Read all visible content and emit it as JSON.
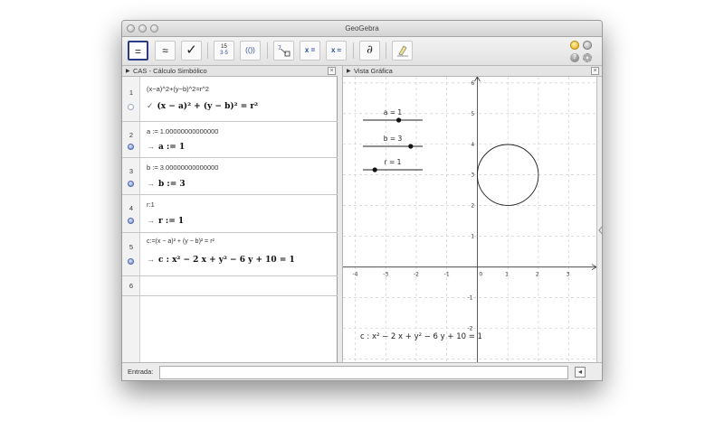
{
  "window": {
    "title": "GeoGebra"
  },
  "toolbar": {
    "tools": [
      {
        "name": "evaluate",
        "label": "="
      },
      {
        "name": "numeric",
        "label": "≈"
      },
      {
        "name": "keep-input",
        "label": "✓"
      },
      {
        "name": "factor",
        "label_top": "15",
        "label_bottom": "3·5"
      },
      {
        "name": "expand",
        "label": "(())"
      },
      {
        "name": "substitute",
        "label": ""
      },
      {
        "name": "solve",
        "label": "x ="
      },
      {
        "name": "nsolve",
        "label": "x ≈"
      },
      {
        "name": "derivative",
        "label": "∂"
      },
      {
        "name": "delete",
        "label": ""
      }
    ]
  },
  "cas_panel": {
    "title": "CAS - Cálculo Simbólico",
    "close": "×"
  },
  "graphics_panel": {
    "title": "Vista Gráfica",
    "close": "×"
  },
  "cas_rows": [
    {
      "num": "1",
      "input": "(x−a)^2+(y−b)^2=r^2",
      "check": "✓",
      "output": "(x − a)² + (y − b)² = r²"
    },
    {
      "num": "2",
      "input": "a := 1.00000000000000",
      "arrow": "→",
      "output": "a := 1"
    },
    {
      "num": "3",
      "input": "b := 3.00000000000000",
      "arrow": "→",
      "output": "b := 3"
    },
    {
      "num": "4",
      "input": "r:1",
      "arrow": "→",
      "output": "r := 1"
    },
    {
      "num": "5",
      "input": "c:=(x − a)² + (y − b)² = r²",
      "arrow": "→",
      "output": "c : x² − 2 x + y² − 6 y + 10 = 1"
    },
    {
      "num": "6",
      "input": "",
      "output": ""
    }
  ],
  "sliders": [
    {
      "label": "a = 1",
      "value": 1,
      "min": -5,
      "max": 5
    },
    {
      "label": "b = 3",
      "value": 3,
      "min": -5,
      "max": 5
    },
    {
      "label": "r = 1",
      "value": 1,
      "min": 0,
      "max": 5
    }
  ],
  "graph": {
    "x_ticks": [
      "-4",
      "-3",
      "-2",
      "-1",
      "0",
      "1",
      "2",
      "3"
    ],
    "y_ticks": [
      "6",
      "5",
      "4",
      "3",
      "2",
      "1",
      "-1",
      "-2"
    ],
    "x_range": [
      -4.4,
      3.9
    ],
    "y_range": [
      -3.1,
      6.2
    ],
    "circle": {
      "cx": 1,
      "cy": 3,
      "r": 1
    },
    "equation_label": "c : x² − 2 x + y² − 6 y + 10 = 1"
  },
  "input_bar": {
    "label": "Entrada:",
    "value": ""
  }
}
